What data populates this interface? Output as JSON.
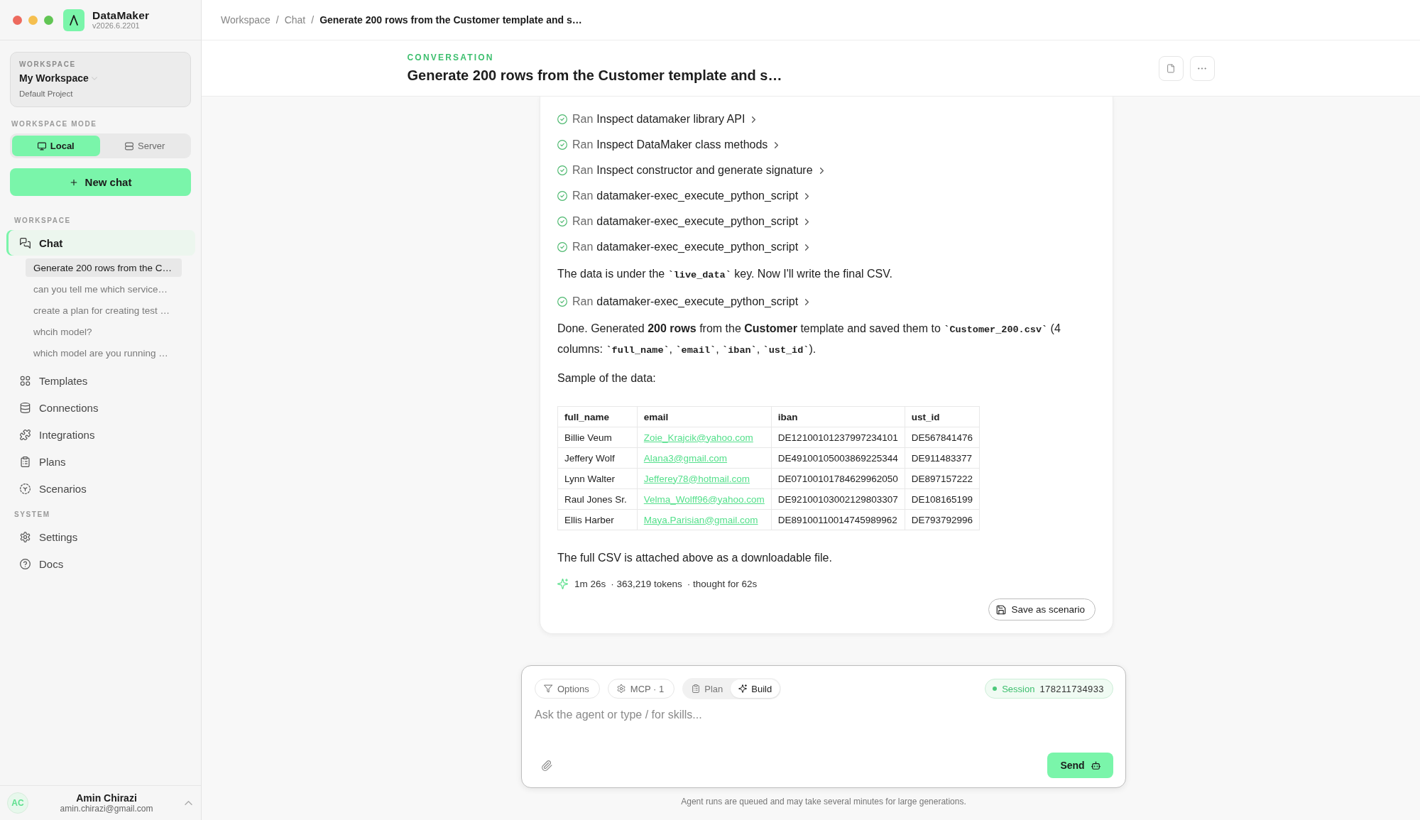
{
  "app": {
    "name": "DataMaker",
    "version": "v2026.6.2201"
  },
  "workspace_card": {
    "label": "WORKSPACE",
    "name": "My Workspace",
    "project": "Default Project"
  },
  "workspace_mode": {
    "label": "WORKSPACE MODE",
    "options": [
      {
        "label": "Local",
        "selected": true
      },
      {
        "label": "Server",
        "selected": false
      }
    ]
  },
  "new_chat_button": "New chat",
  "sidebar": {
    "sections": [
      {
        "label": "WORKSPACE",
        "items": [
          {
            "label": "Chat",
            "selected": true,
            "children": [
              {
                "label": "Generate 200 rows from the C…",
                "selected": true
              },
              {
                "label": "can you tell me which service…",
                "selected": false
              },
              {
                "label": "create a plan for creating test …",
                "selected": false
              },
              {
                "label": "whcih model?",
                "selected": false
              },
              {
                "label": "which model are you running …",
                "selected": false
              }
            ]
          },
          {
            "label": "Templates",
            "selected": false
          },
          {
            "label": "Connections",
            "selected": false
          },
          {
            "label": "Integrations",
            "selected": false
          },
          {
            "label": "Plans",
            "selected": false
          },
          {
            "label": "Scenarios",
            "selected": false
          }
        ]
      },
      {
        "label": "SYSTEM",
        "items": [
          {
            "label": "Settings",
            "selected": false
          },
          {
            "label": "Docs",
            "selected": false
          }
        ]
      }
    ]
  },
  "user": {
    "initials": "AC",
    "name": "Amin Chirazi",
    "email": "amin.chirazi@gmail.com"
  },
  "breadcrumb": [
    {
      "kind": "link",
      "label": "Workspace"
    },
    {
      "kind": "separator",
      "label": "/"
    },
    {
      "kind": "link",
      "label": "Chat"
    },
    {
      "kind": "separator",
      "label": "/"
    },
    {
      "kind": "current",
      "label": "Generate 200 rows from the Customer template and s…"
    }
  ],
  "conversation": {
    "label": "CONVERSATION",
    "title": "Generate 200 rows from the Customer template and s…"
  },
  "message": {
    "blocks": [
      {
        "kind": "tool",
        "verb": "Ran",
        "title": "Inspect datamaker library API"
      },
      {
        "kind": "tool",
        "verb": "Ran",
        "title": "Inspect DataMaker class methods"
      },
      {
        "kind": "tool",
        "verb": "Ran",
        "title": "Inspect constructor and generate signature"
      },
      {
        "kind": "tool",
        "verb": "Ran",
        "title": "datamaker-exec_execute_python_script"
      },
      {
        "kind": "tool",
        "verb": "Ran",
        "title": "datamaker-exec_execute_python_script"
      },
      {
        "kind": "tool",
        "verb": "Ran",
        "title": "datamaker-exec_execute_python_script"
      },
      {
        "kind": "paragraph",
        "segments": [
          {
            "kind": "text",
            "text": "The data is under the "
          },
          {
            "kind": "code",
            "text": "`live_data`"
          },
          {
            "kind": "text",
            "text": " key. Now I'll write the final CSV."
          }
        ]
      },
      {
        "kind": "tool",
        "verb": "Ran",
        "title": "datamaker-exec_execute_python_script"
      },
      {
        "kind": "paragraph",
        "segments": [
          {
            "kind": "text",
            "text": "Done. Generated **200 rows** from the **Customer** template and saved them to "
          },
          {
            "kind": "code",
            "text": "`Customer_200.csv`"
          },
          {
            "kind": "text",
            "text": " (4 columns: "
          },
          {
            "kind": "code",
            "text": "`full_name`"
          },
          {
            "kind": "text",
            "text": ", "
          },
          {
            "kind": "code",
            "text": "`email`"
          },
          {
            "kind": "text",
            "text": ", "
          },
          {
            "kind": "code",
            "text": "`iban`"
          },
          {
            "kind": "text",
            "text": ", "
          },
          {
            "kind": "code",
            "text": "`ust_id`"
          },
          {
            "kind": "text",
            "text": ")."
          }
        ]
      },
      {
        "kind": "paragraph",
        "segments": [
          {
            "kind": "text",
            "text": "Sample of the data:"
          }
        ]
      },
      {
        "kind": "table",
        "columns": [
          {
            "label": "full_name",
            "kind": "text"
          },
          {
            "label": "email",
            "kind": "link"
          },
          {
            "label": "iban",
            "kind": "text"
          },
          {
            "label": "ust_id",
            "kind": "text"
          }
        ],
        "rows": [
          [
            "Billie Veum",
            "Zoie_Krajcik@yahoo.com",
            "DE12100101237997234101",
            "DE567841476"
          ],
          [
            "Jeffery Wolf",
            "Alana3@gmail.com",
            "DE49100105003869225344",
            "DE911483377"
          ],
          [
            "Lynn Walter",
            "Jefferey78@hotmail.com",
            "DE07100101784629962050",
            "DE897157222"
          ],
          [
            "Raul Jones Sr.",
            "Velma_Wolff96@yahoo.com",
            "DE92100103002129803307",
            "DE108165199"
          ],
          [
            "Ellis Harber",
            "Maya.Parisian@gmail.com",
            "DE89100110014745989962",
            "DE793792996"
          ]
        ]
      },
      {
        "kind": "paragraph",
        "segments": [
          {
            "kind": "text",
            "text": "The full CSV is attached above as a downloadable file."
          }
        ]
      }
    ],
    "stats": [
      "1m 26s",
      "· 363,219 tokens",
      "· thought for 62s"
    ],
    "save_button": "Save as scenario"
  },
  "composer": {
    "tools": [
      "Options",
      "MCP · 1"
    ],
    "modes": [
      {
        "label": "Plan",
        "selected": false
      },
      {
        "label": "Build",
        "selected": true
      }
    ],
    "session": {
      "label": "Session",
      "id": "178211734933"
    },
    "placeholder": "Ask the agent or type / for skills...",
    "send_button": "Send"
  },
  "footer_note": "Agent runs are queued and may take several minutes for large generations."
}
